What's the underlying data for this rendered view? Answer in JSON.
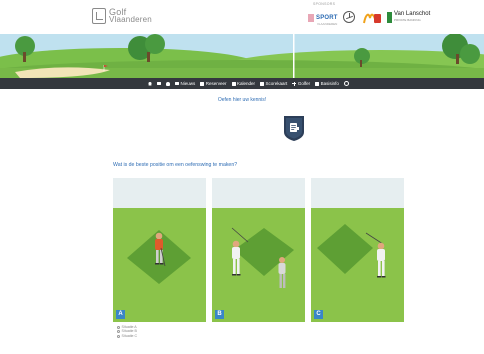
{
  "header": {
    "logo_line1": "Golf",
    "logo_line2": "Vlaanderen",
    "sponsors_label": "SPONSORS",
    "sponsor_sport_name": "SPORT",
    "sponsor_sport_sub": "VLAANDEREN",
    "sponsor_vl_name": "Van Lanschot",
    "sponsor_vl_sub": "PRIVATE BANKING"
  },
  "nav": {
    "items": [
      {
        "label": "",
        "icon": "home-icon"
      },
      {
        "label": "",
        "icon": "mail-icon"
      },
      {
        "label": "",
        "icon": "user-icon"
      },
      {
        "label": "Nieuws",
        "icon": "news-icon"
      },
      {
        "label": "Reserveer",
        "icon": "calendar-icon"
      },
      {
        "label": "Kalender",
        "icon": "calendar-icon"
      },
      {
        "label": "Scorekaart",
        "icon": "scorecard-icon"
      },
      {
        "label": "Golfer",
        "icon": "plus-icon"
      },
      {
        "label": "Basisinfo",
        "icon": "car-icon"
      },
      {
        "label": "",
        "icon": "power-icon"
      }
    ]
  },
  "content": {
    "practice_link": "Oefen hier uw kennis!",
    "question": "Wat is de beste positie om een oefenswing te maken?",
    "options": [
      {
        "label": "A",
        "answer": "Situatie A"
      },
      {
        "label": "B",
        "answer": "Situatie B"
      },
      {
        "label": "C",
        "answer": "Situatie C"
      }
    ]
  },
  "colors": {
    "nav_bg": "#34383e",
    "link_blue": "#2f6db4",
    "card_grass": "#8ac24a",
    "label_blue": "#3a86c7"
  }
}
